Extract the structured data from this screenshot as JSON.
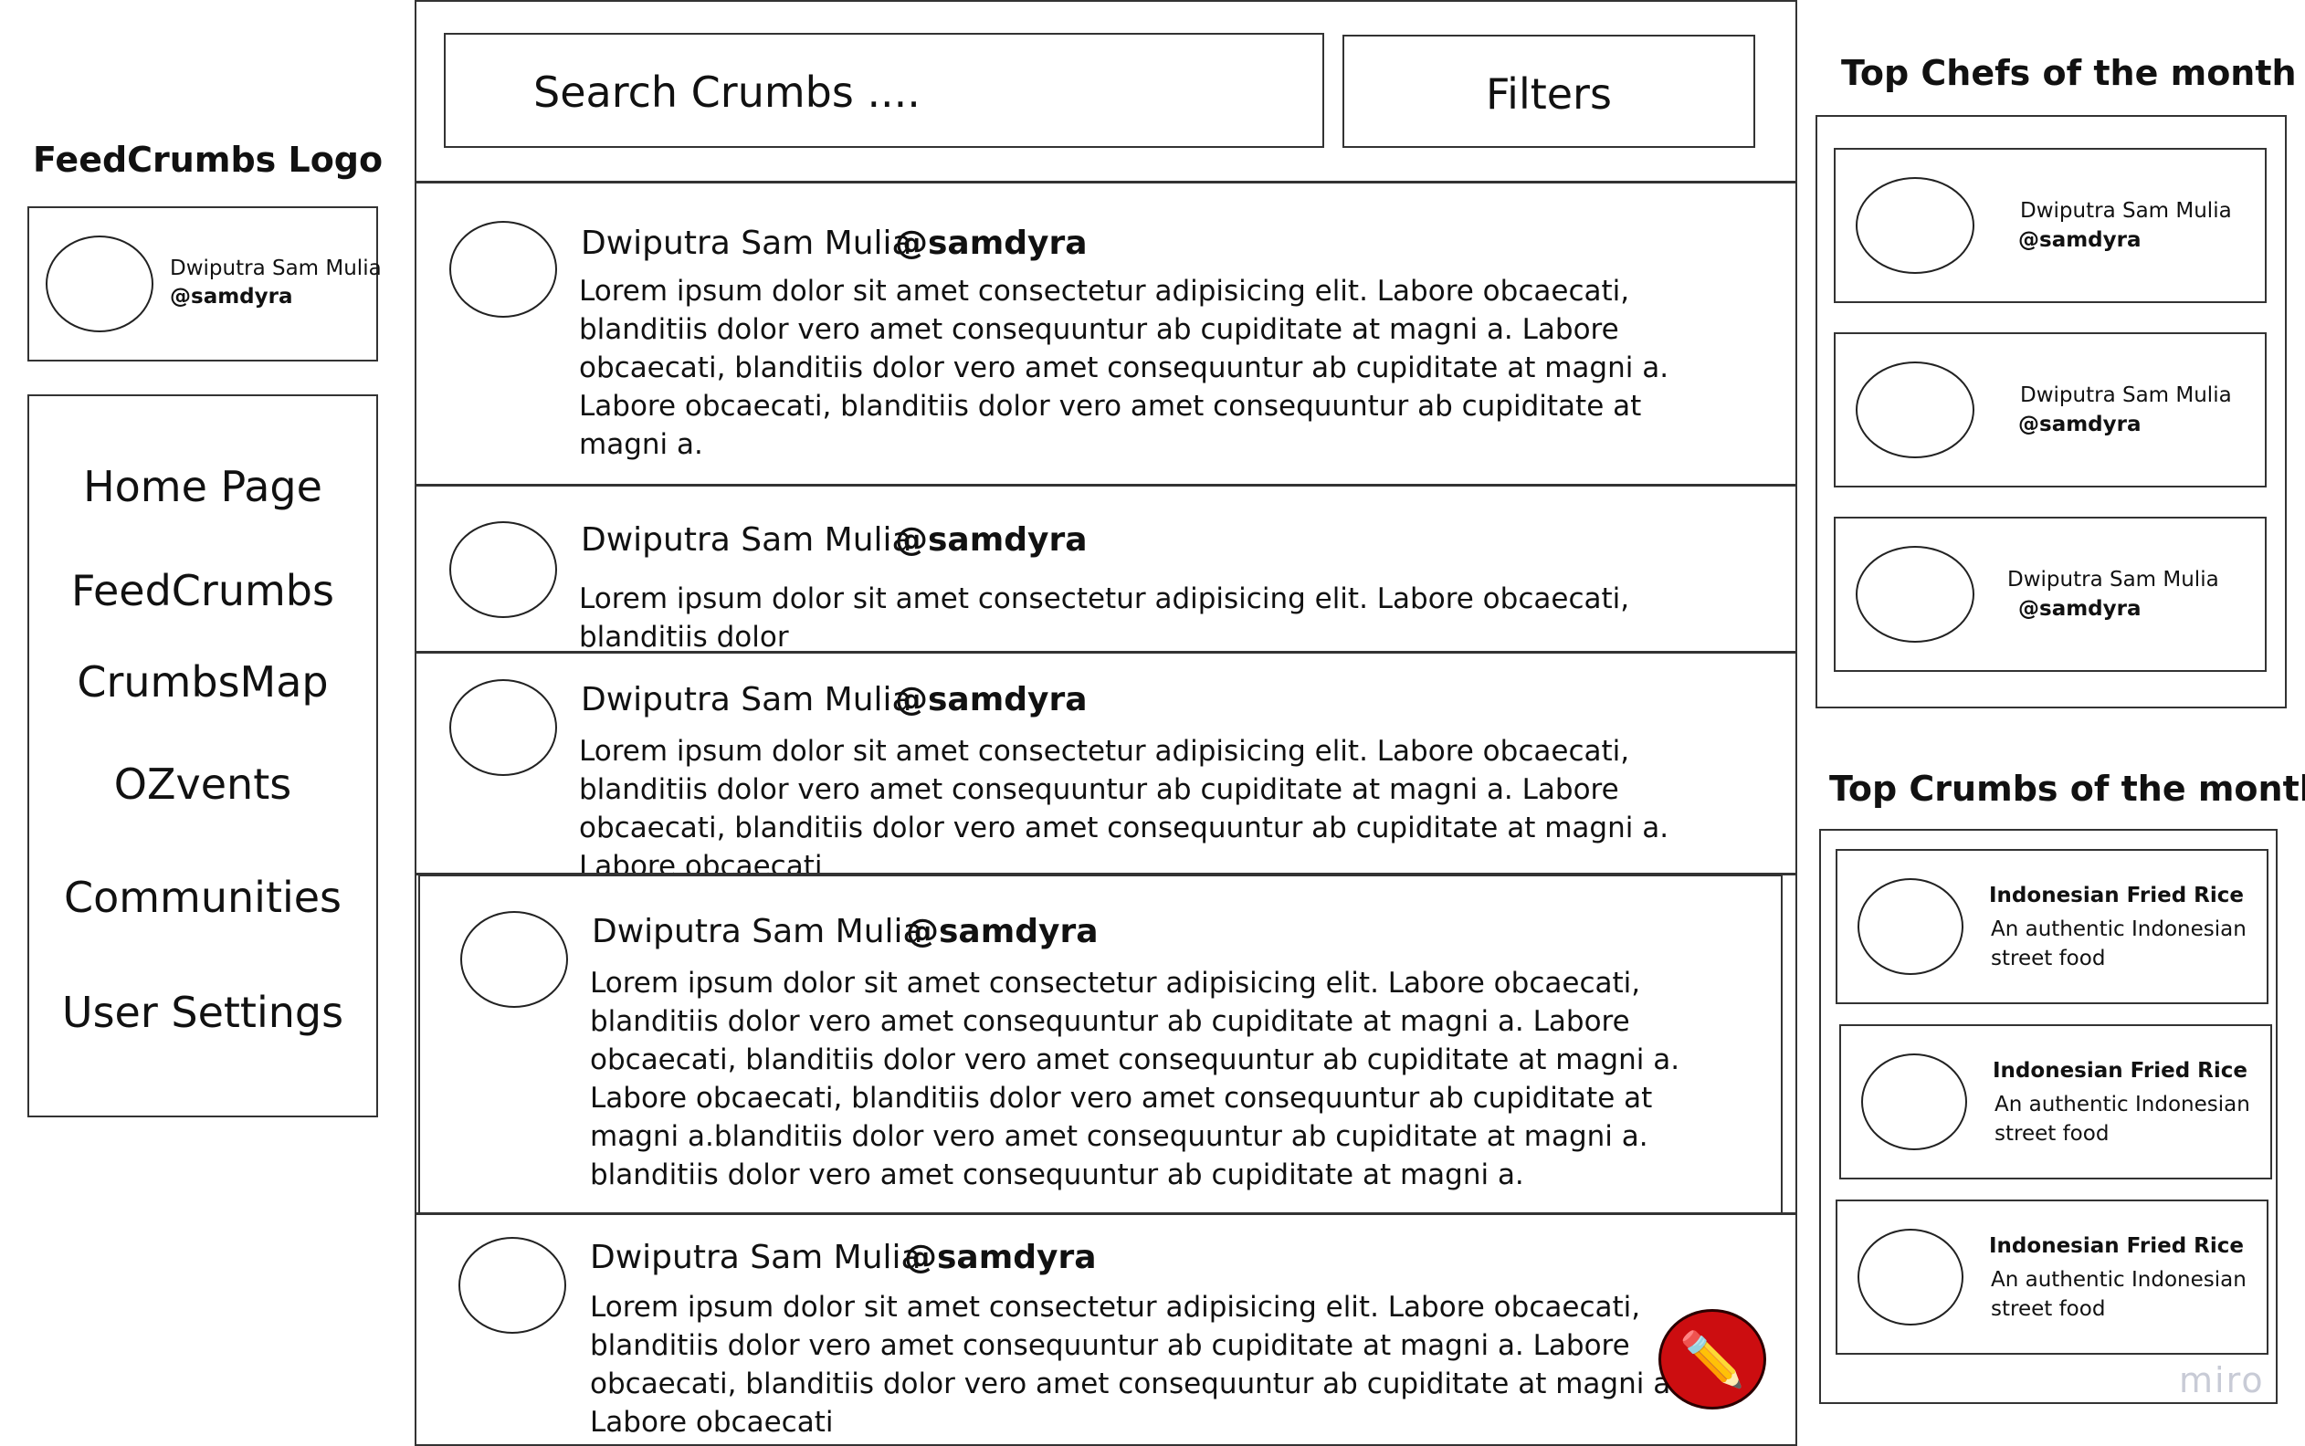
{
  "logo": {
    "label": "FeedCrumbs Logo"
  },
  "profile": {
    "name": "Dwiputra Sam Mulia",
    "handle": "@samdyra"
  },
  "nav": {
    "items": [
      {
        "label": "Home Page"
      },
      {
        "label": "FeedCrumbs"
      },
      {
        "label": "CrumbsMap"
      },
      {
        "label": "OZvents"
      },
      {
        "label": "Communities"
      },
      {
        "label": "User Settings"
      }
    ]
  },
  "search": {
    "placeholder": "Search Crumbs ...."
  },
  "filters": {
    "label": "Filters"
  },
  "posts": [
    {
      "name": "Dwiputra Sam Mulia",
      "handle": "@samdyra",
      "body": "Lorem ipsum dolor sit amet consectetur adipisicing elit. Labore obcaecati, blanditiis dolor vero amet consequuntur ab cupiditate at magni a. Labore obcaecati, blanditiis dolor vero amet consequuntur ab cupiditate at magni a. Labore obcaecati, blanditiis dolor vero amet consequuntur ab cupiditate at magni a."
    },
    {
      "name": "Dwiputra Sam Mulia",
      "handle": "@samdyra",
      "body": "Lorem ipsum dolor sit amet consectetur adipisicing elit. Labore obcaecati, blanditiis dolor"
    },
    {
      "name": "Dwiputra Sam Mulia",
      "handle": "@samdyra",
      "body": "Lorem ipsum dolor sit amet consectetur adipisicing elit. Labore obcaecati, blanditiis dolor vero amet consequuntur ab cupiditate at magni a. Labore obcaecati, blanditiis dolor vero amet consequuntur ab cupiditate at magni a. Labore obcaecati"
    },
    {
      "name": "Dwiputra Sam Mulia",
      "handle": "@samdyra",
      "body": "Lorem ipsum dolor sit amet consectetur adipisicing elit. Labore obcaecati, blanditiis dolor vero amet consequuntur ab cupiditate at magni a. Labore obcaecati, blanditiis dolor vero amet consequuntur ab cupiditate at magni a. Labore obcaecati, blanditiis dolor vero amet consequuntur ab cupiditate at magni a.blanditiis dolor vero amet consequuntur ab cupiditate at magni a. blanditiis dolor vero amet consequuntur ab cupiditate at magni a."
    },
    {
      "name": "Dwiputra Sam Mulia",
      "handle": "@samdyra",
      "body": "Lorem ipsum dolor sit amet consectetur adipisicing elit. Labore obcaecati, blanditiis dolor vero amet consequuntur ab cupiditate at magni a. Labore obcaecati, blanditiis dolor vero amet consequuntur ab cupiditate at magni a. Labore obcaecati"
    }
  ],
  "top_chefs": {
    "title": "Top Chefs of the month",
    "items": [
      {
        "name": "Dwiputra Sam Mulia",
        "handle": "@samdyra"
      },
      {
        "name": "Dwiputra Sam Mulia",
        "handle": "@samdyra"
      },
      {
        "name": "Dwiputra Sam Mulia",
        "handle": "@samdyra"
      }
    ]
  },
  "top_crumbs": {
    "title": "Top Crumbs of the month",
    "items": [
      {
        "title": "Indonesian Fried Rice",
        "description": "An authentic Indonesian street food"
      },
      {
        "title": "Indonesian Fried Rice",
        "description": "An authentic Indonesian street food"
      },
      {
        "title": "Indonesian Fried Rice",
        "description": "An authentic Indonesian street food"
      }
    ]
  },
  "fab": {
    "icon": "pencil-icon",
    "glyph": "✏️",
    "color": "#cc0d10"
  },
  "watermark": {
    "label": "miro"
  }
}
